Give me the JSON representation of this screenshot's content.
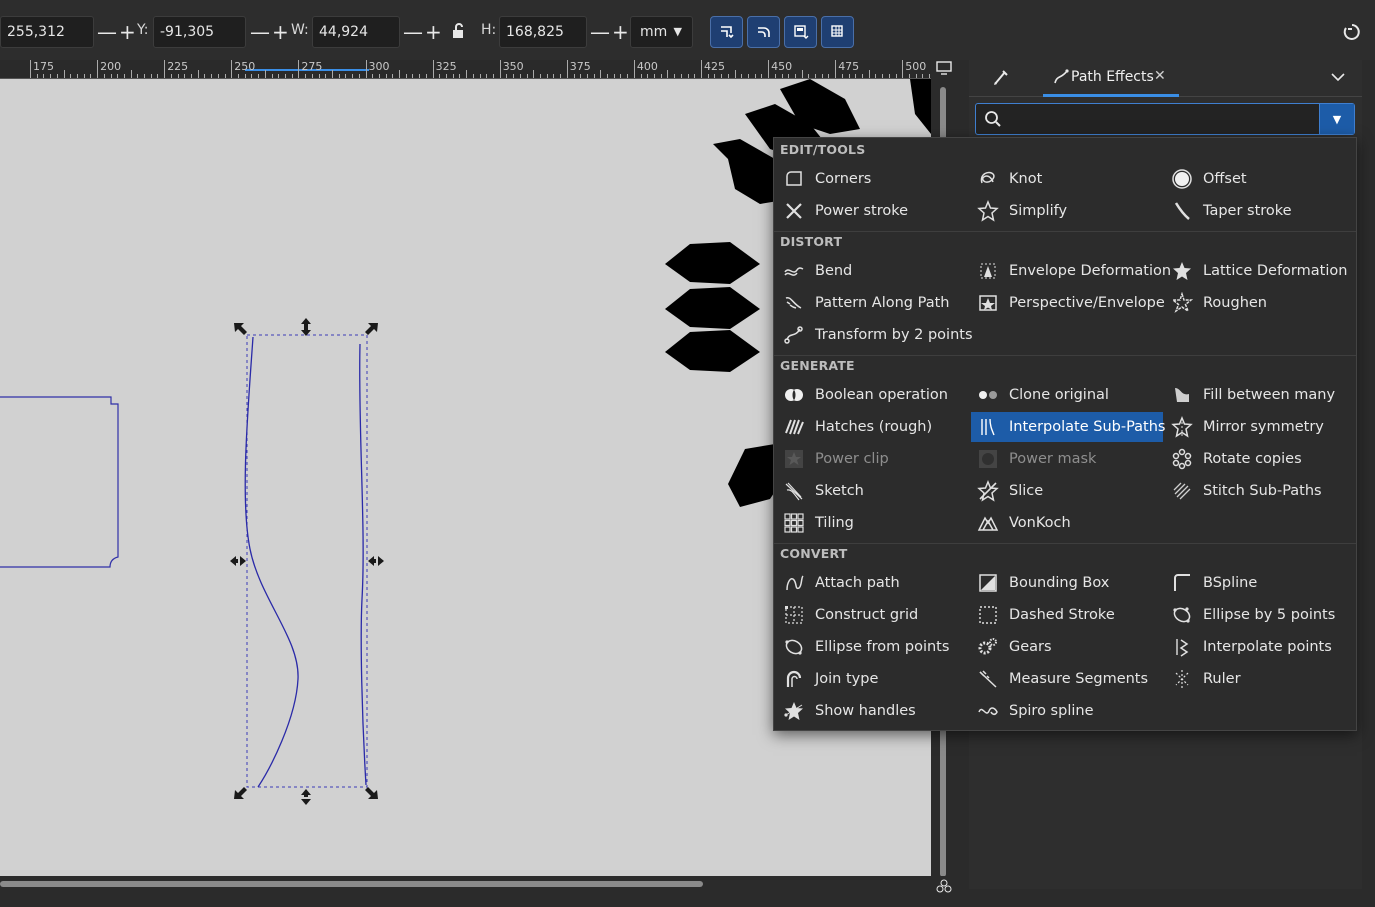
{
  "toolbar": {
    "x_value": "255,312",
    "y_label": "Y:",
    "y_value": "-91,305",
    "w_label": "W:",
    "w_value": "44,924",
    "h_label": "H:",
    "h_value": "168,825",
    "unit": "mm",
    "stepper_glyph": "—+"
  },
  "ruler": {
    "labels": [
      "175",
      "200",
      "225",
      "250",
      "275",
      "300",
      "325",
      "350",
      "375",
      "400",
      "425",
      "450",
      "475",
      "500"
    ]
  },
  "panel": {
    "tab_label": "Path Effects",
    "search_value": "",
    "search_placeholder": ""
  },
  "menu": {
    "categories": [
      {
        "name": "EDIT/TOOLS",
        "items": [
          {
            "label": "Corners",
            "icon": "corners-icon"
          },
          {
            "label": "Knot",
            "icon": "knot-icon"
          },
          {
            "label": "Offset",
            "icon": "offset-icon"
          },
          {
            "label": "Power stroke",
            "icon": "power-stroke-icon"
          },
          {
            "label": "Simplify",
            "icon": "simplify-icon"
          },
          {
            "label": "Taper stroke",
            "icon": "taper-stroke-icon"
          }
        ]
      },
      {
        "name": "DISTORT",
        "items": [
          {
            "label": "Bend",
            "icon": "bend-icon"
          },
          {
            "label": "Envelope Deformation",
            "icon": "envelope-icon"
          },
          {
            "label": "Lattice Deformation",
            "icon": "lattice-icon"
          },
          {
            "label": "Pattern Along Path",
            "icon": "pattern-icon"
          },
          {
            "label": "Perspective/Envelope",
            "icon": "perspective-icon"
          },
          {
            "label": "Roughen",
            "icon": "roughen-icon"
          },
          {
            "label": "Transform by 2 points",
            "icon": "transform-icon"
          }
        ]
      },
      {
        "name": "GENERATE",
        "items": [
          {
            "label": "Boolean operation",
            "icon": "boolean-icon"
          },
          {
            "label": "Clone original",
            "icon": "clone-icon"
          },
          {
            "label": "Fill between many",
            "icon": "fill-between-icon"
          },
          {
            "label": "Hatches (rough)",
            "icon": "hatches-icon"
          },
          {
            "label": "Interpolate Sub-Paths",
            "icon": "interpolate-subpaths-icon",
            "selected": true
          },
          {
            "label": "Mirror symmetry",
            "icon": "mirror-icon"
          },
          {
            "label": "Power clip",
            "icon": "power-clip-icon",
            "disabled": true
          },
          {
            "label": "Power mask",
            "icon": "power-mask-icon",
            "disabled": true
          },
          {
            "label": "Rotate copies",
            "icon": "rotate-copies-icon"
          },
          {
            "label": "Sketch",
            "icon": "sketch-icon"
          },
          {
            "label": "Slice",
            "icon": "slice-icon"
          },
          {
            "label": "Stitch Sub-Paths",
            "icon": "stitch-icon"
          },
          {
            "label": "Tiling",
            "icon": "tiling-icon"
          },
          {
            "label": "VonKoch",
            "icon": "vonkoch-icon"
          }
        ]
      },
      {
        "name": "CONVERT",
        "items": [
          {
            "label": "Attach path",
            "icon": "attach-path-icon"
          },
          {
            "label": "Bounding Box",
            "icon": "bounding-box-icon"
          },
          {
            "label": "BSpline",
            "icon": "bspline-icon"
          },
          {
            "label": "Construct grid",
            "icon": "construct-grid-icon"
          },
          {
            "label": "Dashed Stroke",
            "icon": "dashed-stroke-icon"
          },
          {
            "label": "Ellipse by 5 points",
            "icon": "ellipse-5-icon"
          },
          {
            "label": "Ellipse from points",
            "icon": "ellipse-points-icon"
          },
          {
            "label": "Gears",
            "icon": "gears-icon"
          },
          {
            "label": "Interpolate points",
            "icon": "interpolate-points-icon"
          },
          {
            "label": "Join type",
            "icon": "join-type-icon"
          },
          {
            "label": "Measure Segments",
            "icon": "measure-icon"
          },
          {
            "label": "Ruler",
            "icon": "ruler-icon"
          },
          {
            "label": "Show handles",
            "icon": "show-handles-icon"
          },
          {
            "label": "Spiro spline",
            "icon": "spiro-icon"
          }
        ]
      }
    ]
  },
  "colors": {
    "accent": "#1d5ca8",
    "canvas": "#d1d1d1",
    "path": "#2a2aa8"
  }
}
